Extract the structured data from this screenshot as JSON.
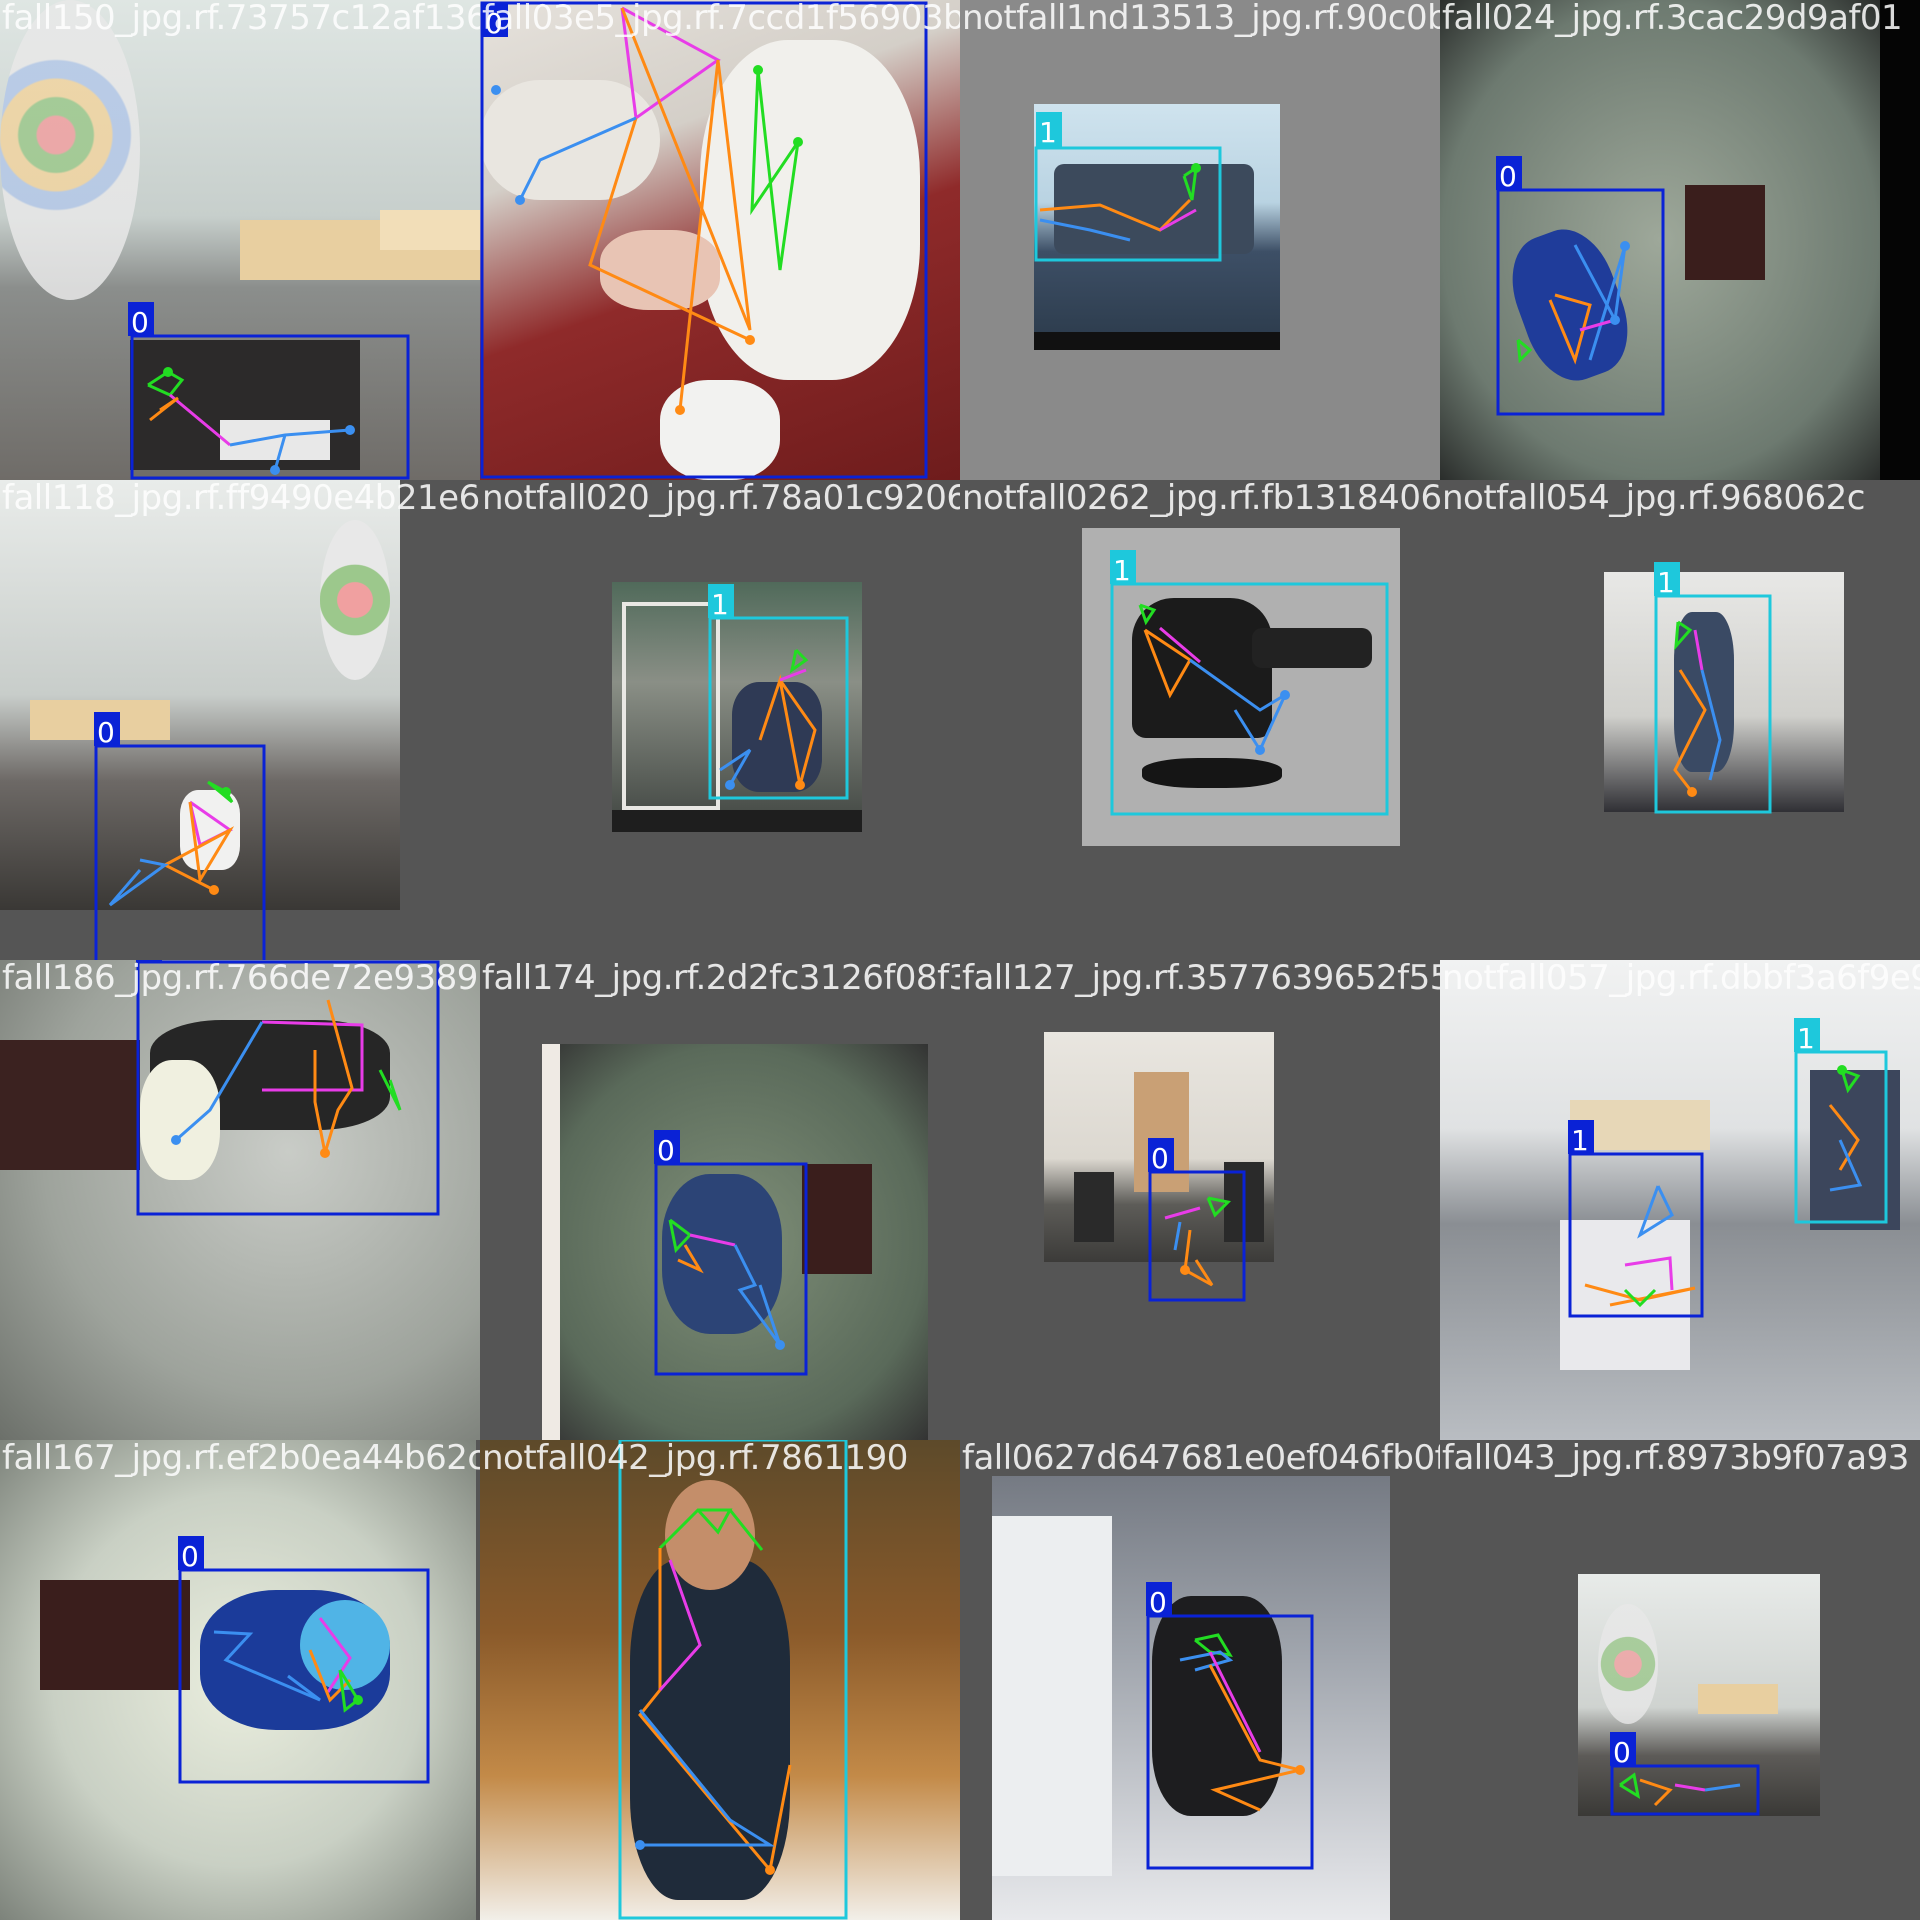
{
  "grid": {
    "cells": [
      {
        "filename": "fall150_jpg.rf.73757c12af136e0a1f3a1ccd1f56903bb6",
        "class_label": "0"
      },
      {
        "filename": "fall03e5_jpg.rf.7ccd1f56903bb6cc8afc1c1c1351",
        "class_label": "0"
      },
      {
        "filename": "notfall1nd13513_jpg.rf.90c0b40fa8d67245350613cac29d9af01",
        "class_label": "1"
      },
      {
        "filename": "fall024_jpg.rf.3cac29d9af01",
        "class_label": "0"
      },
      {
        "filename": "fall118_jpg.rf.ff9490e4b21e6c3e4f4f820052f",
        "class_label": "0"
      },
      {
        "filename": "notfall020_jpg.rf.78a01c920613b90262f",
        "class_label": "1"
      },
      {
        "filename": "notfall0262_jpg.rf.fb1318406153aea054",
        "class_label": "1"
      },
      {
        "filename": "notfall054_jpg.rf.968062c",
        "class_label": "1"
      },
      {
        "filename": "fall186_jpg.rf.766de72e93899",
        "class_label": "0"
      },
      {
        "filename": "fall174_jpg.rf.2d2fc3126f08f31e08f1f312",
        "class_label": "0"
      },
      {
        "filename": "fall127_jpg.rf.3577639652f554ad1d657b6e65dbbf3a6f9e9b",
        "class_label": "0"
      },
      {
        "filename": "notfall057_jpg.rf.dbbf3a6f9e9b",
        "class_label": "1"
      },
      {
        "filename": "fall167_jpg.rf.ef2b0ea44b62c",
        "class_label": "0"
      },
      {
        "filename": "notfall042_jpg.rf.7861190",
        "class_label": "1"
      },
      {
        "filename": "fall0627d647681e0ef046fb0f",
        "class_label": "0"
      },
      {
        "filename": "fall043_jpg.rf.8973b9f07a93",
        "class_label": "0"
      }
    ]
  },
  "colors": {
    "class0": "#0a22d6",
    "class1": "#1ec8dc",
    "keypoint_face": "#22dd22",
    "keypoint_body": "#ff8a14",
    "keypoint_torso": "#e83ce8",
    "keypoint_limbs": "#3b8ff0"
  }
}
